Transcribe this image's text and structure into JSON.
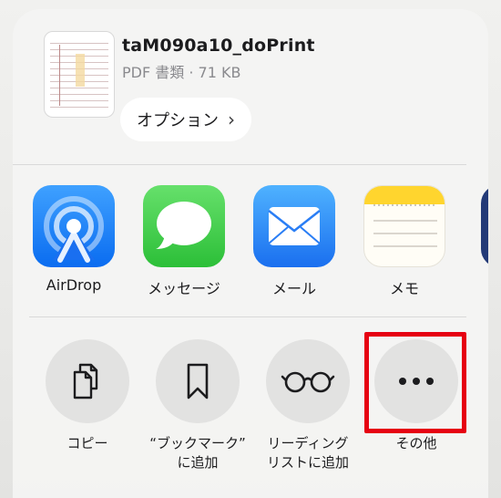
{
  "document": {
    "title": "taM090a10_doPrint",
    "meta": "PDF 書類 · 71 KB",
    "options_label": "オプション",
    "options_chevron": "›"
  },
  "apps": [
    {
      "label": "AirDrop",
      "icon": "airdrop-icon"
    },
    {
      "label": "メッセージ",
      "icon": "messages-icon"
    },
    {
      "label": "メール",
      "icon": "mail-icon"
    },
    {
      "label": "メモ",
      "icon": "notes-icon"
    }
  ],
  "actions": [
    {
      "label": "コピー",
      "icon": "copy-icon"
    },
    {
      "label": "“ブックマーク”\nに追加",
      "icon": "bookmark-icon"
    },
    {
      "label": "リーディング\nリストに追加",
      "icon": "reading-glasses-icon"
    },
    {
      "label": "その他",
      "icon": "more-icon"
    }
  ],
  "colors": {
    "highlight": "#e60012",
    "airdrop": "#1a7ef5",
    "messages": "#34c742",
    "mail": "#2a8bf7"
  }
}
